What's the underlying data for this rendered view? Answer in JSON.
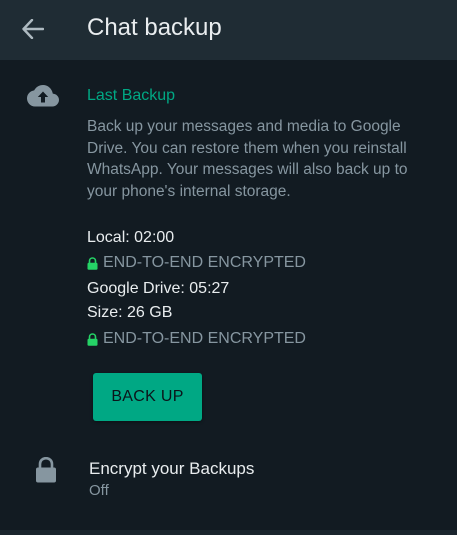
{
  "header": {
    "back_icon": "arrow-left-icon",
    "title": "Chat backup"
  },
  "last_backup": {
    "icon": "cloud-upload-icon",
    "heading": "Last Backup",
    "description": "Back up your messages and media to Google Drive. You can restore them when you reinstall WhatsApp. Your messages will also back up to your phone's internal storage.",
    "local": "Local: 02:00",
    "local_encryption": "END-TO-END ENCRYPTED",
    "google_drive": "Google Drive: 05:27",
    "size": "Size: 26 GB",
    "drive_encryption": "END-TO-END ENCRYPTED",
    "backup_button": "BACK UP"
  },
  "encrypt": {
    "icon": "lock-icon",
    "label": "Encrypt your Backups",
    "status": "Off"
  },
  "colors": {
    "background": "#121b22",
    "app_bar": "#1f2c34",
    "accent": "#00a884",
    "primary_text": "#e9edef",
    "secondary_text": "#8696a0"
  }
}
